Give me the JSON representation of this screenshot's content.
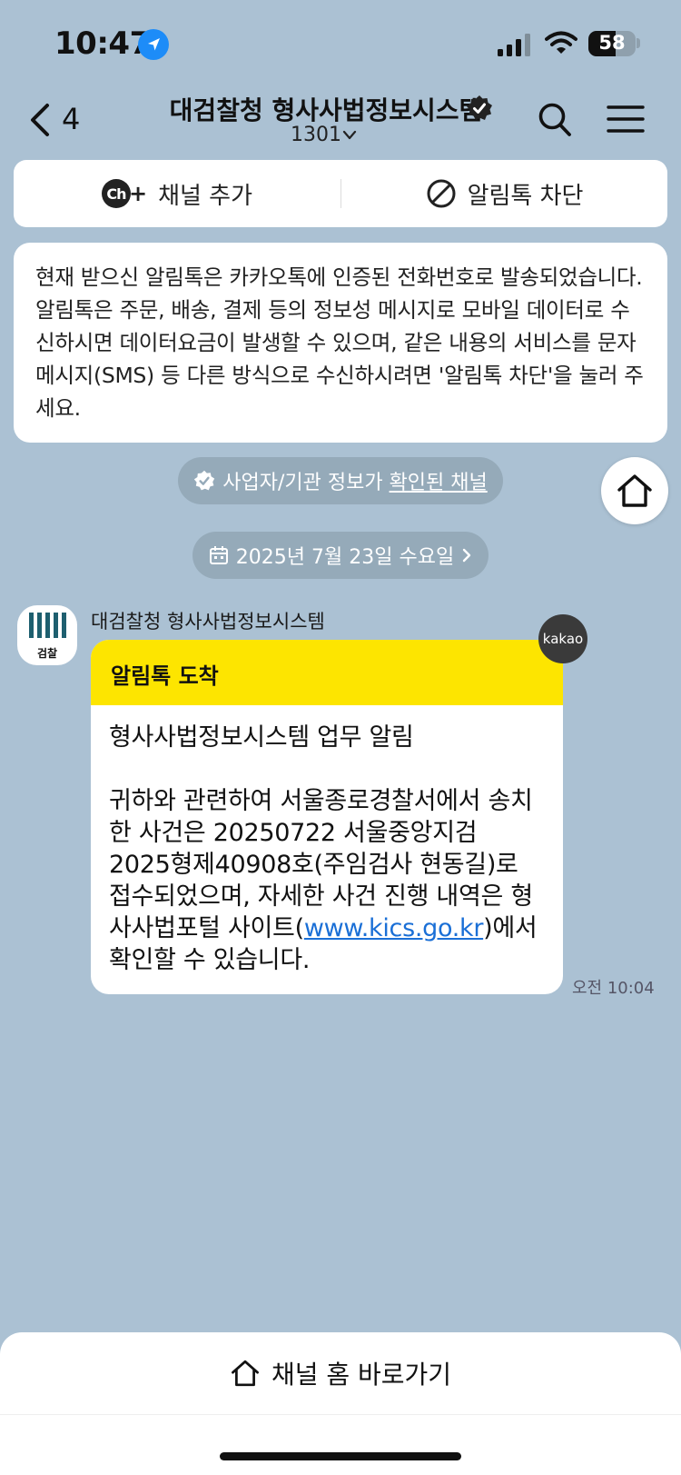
{
  "status_bar": {
    "time": "10:47",
    "battery": "58",
    "battery_level_percent": 58
  },
  "header": {
    "back_count": "4",
    "title": "대검찰청 형사사법정보시스템",
    "subtitle": "1301"
  },
  "channel_actions": {
    "add_channel_label": "채널 추가",
    "add_channel_badge": "Ch",
    "block_label": "알림톡 차단"
  },
  "notice": {
    "text": "현재 받으신 알림톡은 카카오톡에 인증된 전화번호로 발송되었습니다. 알림톡은 주문, 배송, 결제 등의 정보성 메시지로 모바일 데이터로 수신하시면 데이터요금이 발생할 수 있으며, 같은 내용의 서비스를 문자메시지(SMS) 등 다른 방식으로 수신하시려면 '알림톡 차단'을 눌러 주세요."
  },
  "verified_chip": {
    "prefix": "사업자/기관 정보가 ",
    "link": "확인된 채널"
  },
  "date_chip": {
    "label": "2025년 7월 23일 수요일"
  },
  "message": {
    "sender": "대검찰청 형사사법정보시스템",
    "avatar_text": "검찰",
    "header": "알림톡 도착",
    "title": "형사사법정보시스템 업무 알림",
    "body_before": "귀하와 관련하여 서울종로경찰서에서 송치한 사건은 20250722 서울중앙지검 2025형제40908호(주임검사 현동길)로 접수되었으며, 자세한 사건 진행 내역은 형사사법포털 사이트(",
    "link": "www.kics.go.kr",
    "body_after": ")에서 확인할 수 있습니다.",
    "badge": "kakao",
    "time": "오전 10:04"
  },
  "bottom": {
    "home_label": "채널 홈 바로가기"
  },
  "colors": {
    "background": "#abc1d3",
    "alimtalk_yellow": "#fde500",
    "link_blue": "#1a6fd6",
    "chip": "#95aab9"
  }
}
